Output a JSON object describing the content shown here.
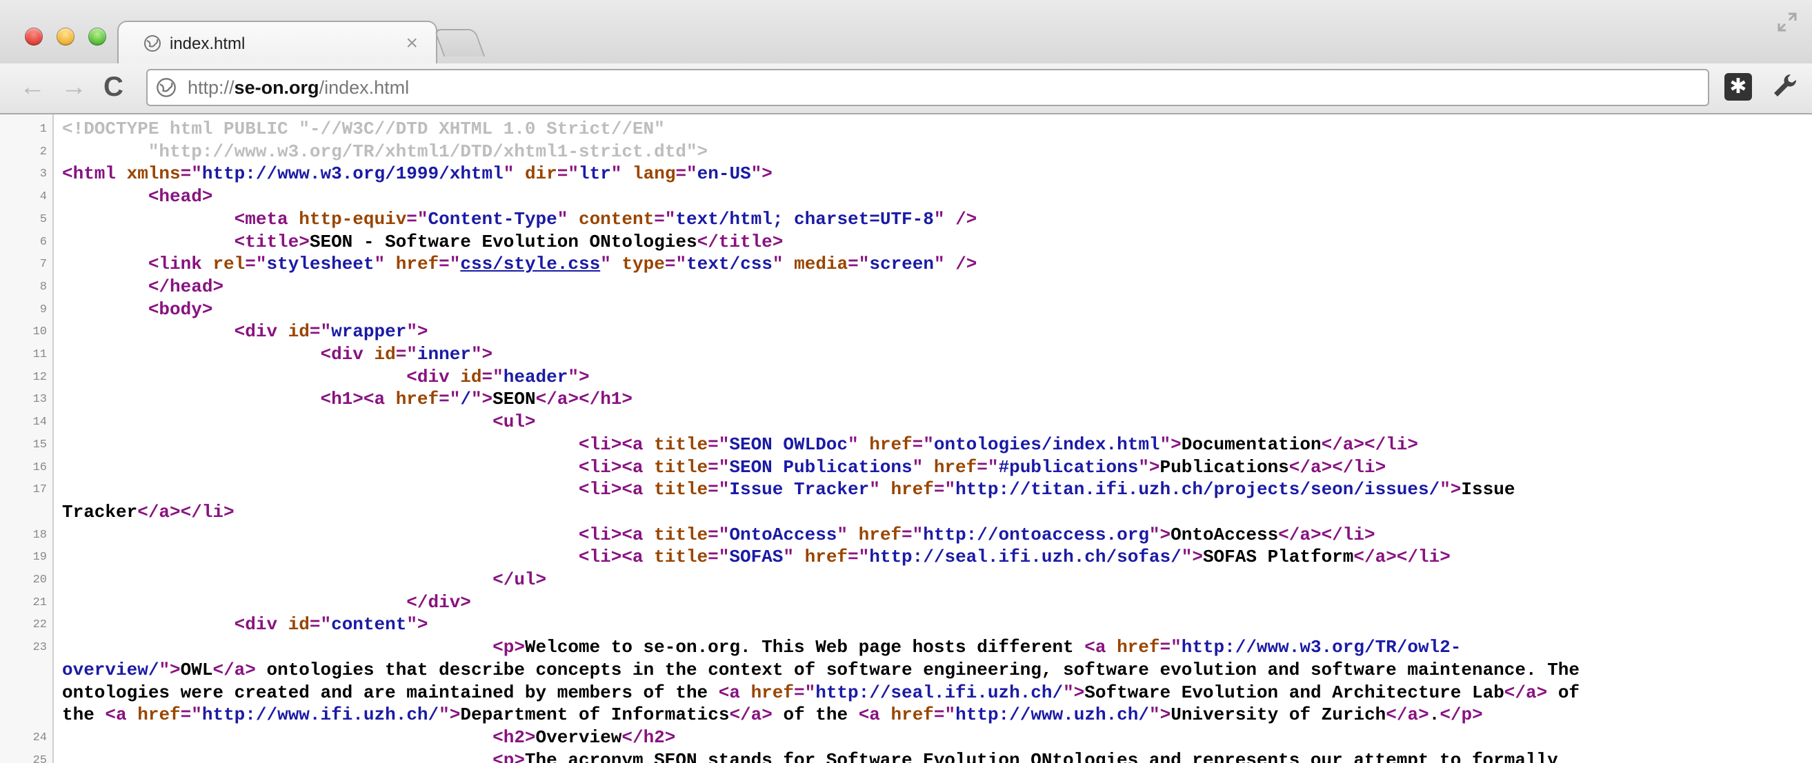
{
  "window": {
    "tab_title": "index.html",
    "tab_close": "×"
  },
  "toolbar": {
    "url_scheme": "http://",
    "url_host": "se-on.org",
    "url_path": "/index.html"
  },
  "source_lines": [
    {
      "n": "1",
      "parts": [
        [
          "cm",
          "<!DOCTYPE html PUBLIC \"-//W3C//DTD XHTML 1.0 Strict//EN\""
        ]
      ]
    },
    {
      "n": "2",
      "parts": [
        [
          "cm",
          "        \"http://www.w3.org/TR/xhtml1/DTD/xhtml1-strict.dtd\">"
        ]
      ]
    },
    {
      "n": "3",
      "parts": [
        [
          "tg",
          "<html "
        ],
        [
          "at",
          "xmlns"
        ],
        [
          "tg",
          "=\""
        ],
        [
          "av",
          "http://www.w3.org/1999/xhtml"
        ],
        [
          "tg",
          "\" "
        ],
        [
          "at",
          "dir"
        ],
        [
          "tg",
          "=\""
        ],
        [
          "av",
          "ltr"
        ],
        [
          "tg",
          "\" "
        ],
        [
          "at",
          "lang"
        ],
        [
          "tg",
          "=\""
        ],
        [
          "av",
          "en-US"
        ],
        [
          "tg",
          "\">"
        ]
      ]
    },
    {
      "n": "4",
      "parts": [
        [
          "t",
          "        "
        ],
        [
          "tg",
          "<head>"
        ]
      ]
    },
    {
      "n": "5",
      "parts": [
        [
          "t",
          "                "
        ],
        [
          "tg",
          "<meta "
        ],
        [
          "at",
          "http-equiv"
        ],
        [
          "tg",
          "=\""
        ],
        [
          "av",
          "Content-Type"
        ],
        [
          "tg",
          "\" "
        ],
        [
          "at",
          "content"
        ],
        [
          "tg",
          "=\""
        ],
        [
          "av",
          "text/html; charset=UTF-8"
        ],
        [
          "tg",
          "\" />"
        ]
      ]
    },
    {
      "n": "6",
      "parts": [
        [
          "t",
          "                "
        ],
        [
          "tg",
          "<title>"
        ],
        [
          "t",
          "SEON - Software Evolution ONtologies"
        ],
        [
          "tg",
          "</title>"
        ]
      ]
    },
    {
      "n": "7",
      "parts": [
        [
          "t",
          "        "
        ],
        [
          "tg",
          "<link "
        ],
        [
          "at",
          "rel"
        ],
        [
          "tg",
          "=\""
        ],
        [
          "av",
          "stylesheet"
        ],
        [
          "tg",
          "\" "
        ],
        [
          "at",
          "href"
        ],
        [
          "tg",
          "=\""
        ],
        [
          "lk",
          "css/style.css"
        ],
        [
          "tg",
          "\" "
        ],
        [
          "at",
          "type"
        ],
        [
          "tg",
          "=\""
        ],
        [
          "av",
          "text/css"
        ],
        [
          "tg",
          "\" "
        ],
        [
          "at",
          "media"
        ],
        [
          "tg",
          "=\""
        ],
        [
          "av",
          "screen"
        ],
        [
          "tg",
          "\" />"
        ]
      ]
    },
    {
      "n": "8",
      "parts": [
        [
          "t",
          "        "
        ],
        [
          "tg",
          "</head>"
        ]
      ]
    },
    {
      "n": "9",
      "parts": [
        [
          "t",
          "        "
        ],
        [
          "tg",
          "<body>"
        ]
      ]
    },
    {
      "n": "10",
      "parts": [
        [
          "t",
          "                "
        ],
        [
          "tg",
          "<div "
        ],
        [
          "at",
          "id"
        ],
        [
          "tg",
          "=\""
        ],
        [
          "av",
          "wrapper"
        ],
        [
          "tg",
          "\">"
        ]
      ]
    },
    {
      "n": "11",
      "parts": [
        [
          "t",
          "                        "
        ],
        [
          "tg",
          "<div "
        ],
        [
          "at",
          "id"
        ],
        [
          "tg",
          "=\""
        ],
        [
          "av",
          "inner"
        ],
        [
          "tg",
          "\">"
        ]
      ]
    },
    {
      "n": "12",
      "parts": [
        [
          "t",
          "                                "
        ],
        [
          "tg",
          "<div "
        ],
        [
          "at",
          "id"
        ],
        [
          "tg",
          "=\""
        ],
        [
          "av",
          "header"
        ],
        [
          "tg",
          "\">"
        ]
      ]
    },
    {
      "n": "13",
      "parts": [
        [
          "t",
          "                        "
        ],
        [
          "tg",
          "<h1><a "
        ],
        [
          "at",
          "href"
        ],
        [
          "tg",
          "=\""
        ],
        [
          "av",
          "/"
        ],
        [
          "tg",
          "\">"
        ],
        [
          "t",
          "SEON"
        ],
        [
          "tg",
          "</a></h1>"
        ]
      ]
    },
    {
      "n": "14",
      "parts": [
        [
          "t",
          "                                        "
        ],
        [
          "tg",
          "<ul>"
        ]
      ]
    },
    {
      "n": "15",
      "parts": [
        [
          "t",
          "                                                "
        ],
        [
          "tg",
          "<li><a "
        ],
        [
          "at",
          "title"
        ],
        [
          "tg",
          "=\""
        ],
        [
          "av",
          "SEON OWLDoc"
        ],
        [
          "tg",
          "\" "
        ],
        [
          "at",
          "href"
        ],
        [
          "tg",
          "=\""
        ],
        [
          "av",
          "ontologies/index.html"
        ],
        [
          "tg",
          "\">"
        ],
        [
          "t",
          "Documentation"
        ],
        [
          "tg",
          "</a></li>"
        ]
      ]
    },
    {
      "n": "16",
      "parts": [
        [
          "t",
          "                                                "
        ],
        [
          "tg",
          "<li><a "
        ],
        [
          "at",
          "title"
        ],
        [
          "tg",
          "=\""
        ],
        [
          "av",
          "SEON Publications"
        ],
        [
          "tg",
          "\" "
        ],
        [
          "at",
          "href"
        ],
        [
          "tg",
          "=\""
        ],
        [
          "av",
          "#publications"
        ],
        [
          "tg",
          "\">"
        ],
        [
          "t",
          "Publications"
        ],
        [
          "tg",
          "</a></li>"
        ]
      ]
    },
    {
      "n": "17",
      "parts": [
        [
          "t",
          "                                                "
        ],
        [
          "tg",
          "<li><a "
        ],
        [
          "at",
          "title"
        ],
        [
          "tg",
          "=\""
        ],
        [
          "av",
          "Issue Tracker"
        ],
        [
          "tg",
          "\" "
        ],
        [
          "at",
          "href"
        ],
        [
          "tg",
          "=\""
        ],
        [
          "av",
          "http://titan.ifi.uzh.ch/projects/seon/issues/"
        ],
        [
          "tg",
          "\">"
        ],
        [
          "t",
          "Issue"
        ]
      ]
    },
    {
      "n": "",
      "parts": [
        [
          "t",
          "Tracker"
        ],
        [
          "tg",
          "</a></li>"
        ]
      ]
    },
    {
      "n": "18",
      "parts": [
        [
          "t",
          "                                                "
        ],
        [
          "tg",
          "<li><a "
        ],
        [
          "at",
          "title"
        ],
        [
          "tg",
          "=\""
        ],
        [
          "av",
          "OntoAccess"
        ],
        [
          "tg",
          "\" "
        ],
        [
          "at",
          "href"
        ],
        [
          "tg",
          "=\""
        ],
        [
          "av",
          "http://ontoaccess.org"
        ],
        [
          "tg",
          "\">"
        ],
        [
          "t",
          "OntoAccess"
        ],
        [
          "tg",
          "</a></li>"
        ]
      ]
    },
    {
      "n": "19",
      "parts": [
        [
          "t",
          "                                                "
        ],
        [
          "tg",
          "<li><a "
        ],
        [
          "at",
          "title"
        ],
        [
          "tg",
          "=\""
        ],
        [
          "av",
          "SOFAS"
        ],
        [
          "tg",
          "\" "
        ],
        [
          "at",
          "href"
        ],
        [
          "tg",
          "=\""
        ],
        [
          "av",
          "http://seal.ifi.uzh.ch/sofas/"
        ],
        [
          "tg",
          "\">"
        ],
        [
          "t",
          "SOFAS Platform"
        ],
        [
          "tg",
          "</a></li>"
        ]
      ]
    },
    {
      "n": "20",
      "parts": [
        [
          "t",
          "                                        "
        ],
        [
          "tg",
          "</ul>"
        ]
      ]
    },
    {
      "n": "21",
      "parts": [
        [
          "t",
          "                                "
        ],
        [
          "tg",
          "</div>"
        ]
      ]
    },
    {
      "n": "22",
      "parts": [
        [
          "t",
          "                "
        ],
        [
          "tg",
          "<div "
        ],
        [
          "at",
          "id"
        ],
        [
          "tg",
          "=\""
        ],
        [
          "av",
          "content"
        ],
        [
          "tg",
          "\">"
        ]
      ]
    },
    {
      "n": "23",
      "parts": [
        [
          "t",
          "                                        "
        ],
        [
          "tg",
          "<p>"
        ],
        [
          "t",
          "Welcome to se-on.org. This Web page hosts different "
        ],
        [
          "tg",
          "<a "
        ],
        [
          "at",
          "href"
        ],
        [
          "tg",
          "=\""
        ],
        [
          "av",
          "http://www.w3.org/TR/owl2-"
        ]
      ]
    },
    {
      "n": "",
      "parts": [
        [
          "av",
          "overview/"
        ],
        [
          "tg",
          "\">"
        ],
        [
          "t",
          "OWL"
        ],
        [
          "tg",
          "</a>"
        ],
        [
          "t",
          " ontologies that describe concepts in the context of software engineering, software evolution and software maintenance. The"
        ]
      ]
    },
    {
      "n": "",
      "parts": [
        [
          "t",
          "ontologies were created and are maintained by members of the "
        ],
        [
          "tg",
          "<a "
        ],
        [
          "at",
          "href"
        ],
        [
          "tg",
          "=\""
        ],
        [
          "av",
          "http://seal.ifi.uzh.ch/"
        ],
        [
          "tg",
          "\">"
        ],
        [
          "t",
          "Software Evolution and Architecture Lab"
        ],
        [
          "tg",
          "</a>"
        ],
        [
          "t",
          " of"
        ]
      ]
    },
    {
      "n": "",
      "parts": [
        [
          "t",
          "the "
        ],
        [
          "tg",
          "<a "
        ],
        [
          "at",
          "href"
        ],
        [
          "tg",
          "=\""
        ],
        [
          "av",
          "http://www.ifi.uzh.ch/"
        ],
        [
          "tg",
          "\">"
        ],
        [
          "t",
          "Department of Informatics"
        ],
        [
          "tg",
          "</a>"
        ],
        [
          "t",
          " of the "
        ],
        [
          "tg",
          "<a "
        ],
        [
          "at",
          "href"
        ],
        [
          "tg",
          "=\""
        ],
        [
          "av",
          "http://www.uzh.ch/"
        ],
        [
          "tg",
          "\">"
        ],
        [
          "t",
          "University of Zurich"
        ],
        [
          "tg",
          "</a>"
        ],
        [
          "t",
          "."
        ],
        [
          "tg",
          "</p>"
        ]
      ]
    },
    {
      "n": "24",
      "parts": [
        [
          "t",
          "                                        "
        ],
        [
          "tg",
          "<h2>"
        ],
        [
          "t",
          "Overview"
        ],
        [
          "tg",
          "</h2>"
        ]
      ]
    },
    {
      "n": "25",
      "parts": [
        [
          "t",
          "                                        "
        ],
        [
          "tg",
          "<p>"
        ],
        [
          "t",
          "The acronym SEON stands for Software Evolution ONtologies and represents our attempt to formally"
        ]
      ]
    }
  ]
}
